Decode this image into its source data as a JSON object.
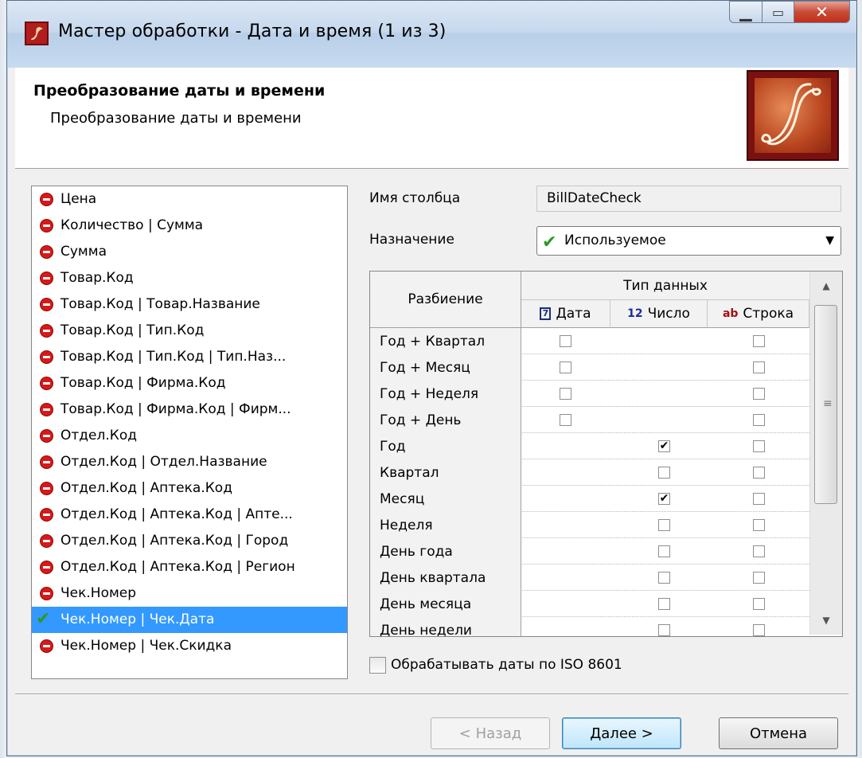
{
  "window": {
    "title": "Мастер обработки - Дата и время (1 из 3)"
  },
  "header": {
    "title": "Преобразование даты и времени",
    "subtitle": "Преобразование даты и времени"
  },
  "column_list": {
    "items": [
      {
        "label": "Цена",
        "state": "excluded"
      },
      {
        "label": "Количество | Сумма",
        "state": "excluded"
      },
      {
        "label": "Сумма",
        "state": "excluded"
      },
      {
        "label": "Товар.Код",
        "state": "excluded"
      },
      {
        "label": "Товар.Код | Товар.Название",
        "state": "excluded"
      },
      {
        "label": "Товар.Код | Тип.Код",
        "state": "excluded"
      },
      {
        "label": "Товар.Код | Тип.Код | Тип.Наз...",
        "state": "excluded"
      },
      {
        "label": "Товар.Код | Фирма.Код",
        "state": "excluded"
      },
      {
        "label": "Товар.Код | Фирма.Код | Фирм...",
        "state": "excluded"
      },
      {
        "label": "Отдел.Код",
        "state": "excluded"
      },
      {
        "label": "Отдел.Код | Отдел.Название",
        "state": "excluded"
      },
      {
        "label": "Отдел.Код | Аптека.Код",
        "state": "excluded"
      },
      {
        "label": "Отдел.Код | Аптека.Код | Апте...",
        "state": "excluded"
      },
      {
        "label": "Отдел.Код | Аптека.Код | Город",
        "state": "excluded"
      },
      {
        "label": "Отдел.Код | Аптека.Код | Регион",
        "state": "excluded"
      },
      {
        "label": "Чек.Номер",
        "state": "excluded"
      },
      {
        "label": "Чек.Номер | Чек.Дата",
        "state": "used",
        "selected": true
      },
      {
        "label": "Чек.Номер | Чек.Скидка",
        "state": "excluded"
      }
    ]
  },
  "form": {
    "column_name_label": "Имя столбца",
    "column_name_value": "BillDateCheck",
    "purpose_label": "Назначение",
    "purpose_value": "Используемое"
  },
  "grid": {
    "row_header": "Разбиение",
    "group_header": "Тип данных",
    "columns": [
      {
        "label": "Дата",
        "icon": "calendar-icon",
        "icon_text": "7"
      },
      {
        "label": "Число",
        "icon": "number-icon",
        "icon_text": "12"
      },
      {
        "label": "Строка",
        "icon": "string-icon",
        "icon_text": "ab"
      }
    ],
    "rows": [
      {
        "label": "Год + Квартал",
        "cells": [
          false,
          null,
          false
        ]
      },
      {
        "label": "Год + Месяц",
        "cells": [
          false,
          null,
          false
        ]
      },
      {
        "label": "Год + Неделя",
        "cells": [
          false,
          null,
          false
        ]
      },
      {
        "label": "Год + День",
        "cells": [
          false,
          null,
          false
        ]
      },
      {
        "label": "Год",
        "cells": [
          null,
          true,
          false
        ]
      },
      {
        "label": "Квартал",
        "cells": [
          null,
          false,
          false
        ]
      },
      {
        "label": "Месяц",
        "cells": [
          null,
          true,
          false
        ]
      },
      {
        "label": "Неделя",
        "cells": [
          null,
          false,
          false
        ]
      },
      {
        "label": "День года",
        "cells": [
          null,
          false,
          false
        ]
      },
      {
        "label": "День квартала",
        "cells": [
          null,
          false,
          false
        ]
      },
      {
        "label": "День месяца",
        "cells": [
          null,
          false,
          false
        ]
      },
      {
        "label": "День недели",
        "cells": [
          null,
          false,
          false
        ]
      }
    ]
  },
  "iso_option": {
    "label": "Обрабатывать даты по ISO 8601",
    "checked": false
  },
  "buttons": {
    "back": "< Назад",
    "next": "Далее >",
    "cancel": "Отмена"
  },
  "colors": {
    "selection": "#3399ff",
    "excluded": "#d91818",
    "used": "#2a9a26"
  }
}
